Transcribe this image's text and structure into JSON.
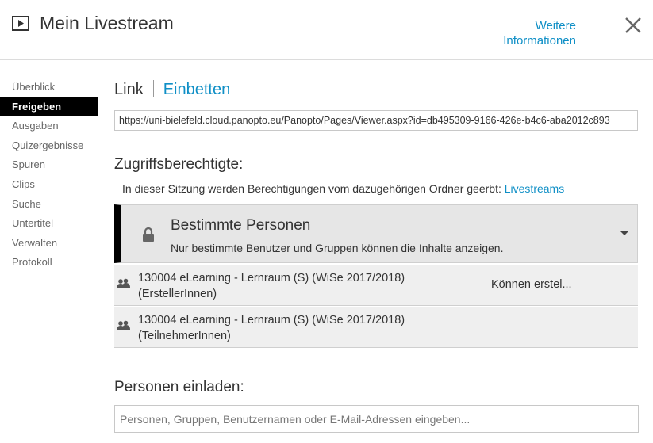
{
  "header": {
    "title": "Mein Livestream",
    "more_info_line1": "Weitere",
    "more_info_line2": "Informationen"
  },
  "sidebar": {
    "items": [
      {
        "label": "Überblick",
        "active": false
      },
      {
        "label": "Freigeben",
        "active": true
      },
      {
        "label": "Ausgaben",
        "active": false
      },
      {
        "label": "Quizergebnisse",
        "active": false
      },
      {
        "label": "Spuren",
        "active": false
      },
      {
        "label": "Clips",
        "active": false
      },
      {
        "label": "Suche",
        "active": false
      },
      {
        "label": "Untertitel",
        "active": false
      },
      {
        "label": "Verwalten",
        "active": false
      },
      {
        "label": "Protokoll",
        "active": false
      }
    ]
  },
  "tabs": {
    "link": "Link",
    "embed": "Einbetten"
  },
  "link_url": "https://uni-bielefeld.cloud.panopto.eu/Panopto/Pages/Viewer.aspx?id=db495309-9166-426e-b4c6-aba2012c893",
  "access": {
    "heading": "Zugriffsberechtigte:",
    "inherit_note": "In dieser Sitzung werden Berechtigungen vom dazugehörigen Ordner geerbt:",
    "inherit_folder": "Livestreams",
    "permission_title": "Bestimmte Personen",
    "permission_desc": "Nur bestimmte Benutzer und Gruppen können die Inhalte anzeigen.",
    "entries": [
      {
        "line1": "130004 eLearning - Lernraum (S) (WiSe 2017/2018)",
        "line2": "(ErstellerInnen)",
        "role": "Können erstel..."
      },
      {
        "line1": "130004 eLearning - Lernraum (S) (WiSe 2017/2018)",
        "line2": "(TeilnehmerInnen)",
        "role": ""
      }
    ]
  },
  "invite": {
    "heading": "Personen einladen:",
    "placeholder": "Personen, Gruppen, Benutzernamen oder E-Mail-Adressen eingeben..."
  },
  "colors": {
    "accent": "#0f8fc6",
    "active_nav_bg": "#000000",
    "permission_bg": "#e6e6e6"
  }
}
